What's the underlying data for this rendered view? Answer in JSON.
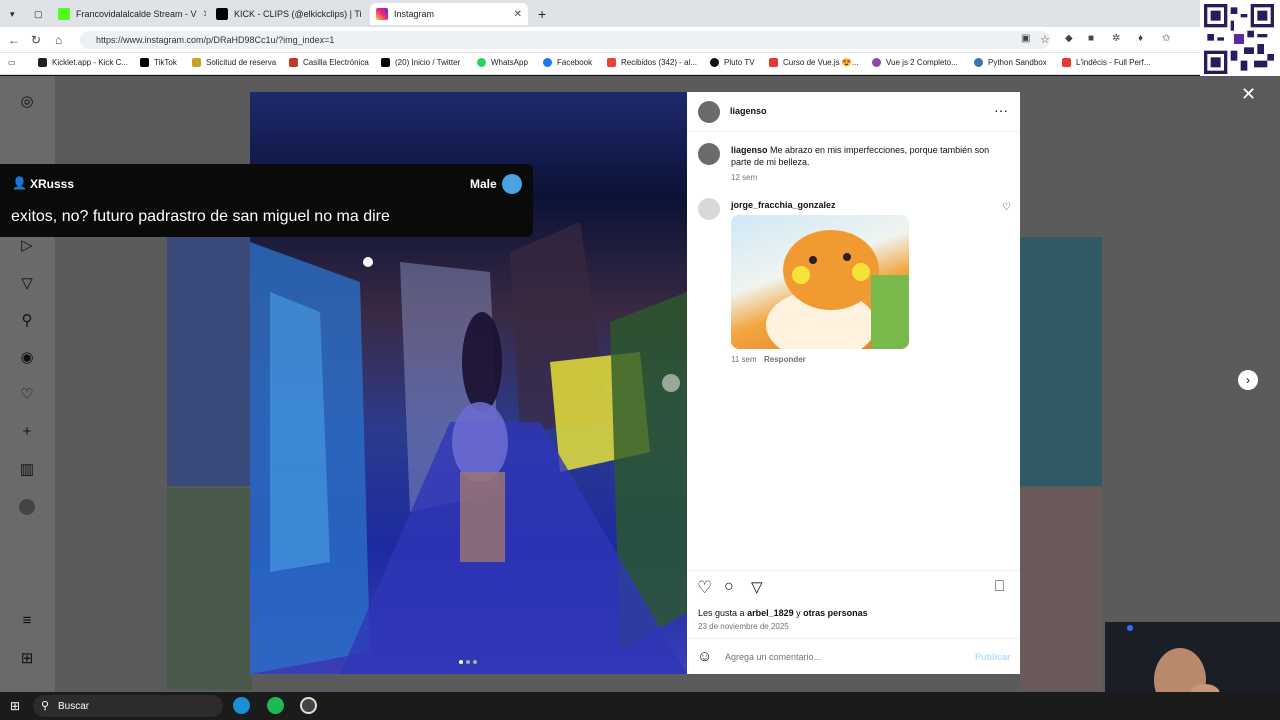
{
  "browser": {
    "tabs": [
      {
        "label": "Francovidalalcalde Stream - V",
        "color": "#53fc18"
      },
      {
        "label": "KICK - CLIPS (@elkickclips) | Ti",
        "color": "#000000"
      },
      {
        "label": "Instagram",
        "color": "#d62976"
      }
    ],
    "url": "https://www.instagram.com/p/DRaHD98Cc1u/?img_index=1",
    "bookmarks": [
      {
        "label": "Kicklet.app - Kick C...",
        "color": "#222"
      },
      {
        "label": "TikTok",
        "color": "#000"
      },
      {
        "label": "Solicitud de reserva",
        "color": "#c9a227"
      },
      {
        "label": "Casilla Electrónica",
        "color": "#c0392b"
      },
      {
        "label": "(20) Inicio / Twitter",
        "color": "#000"
      },
      {
        "label": "WhatsApp",
        "color": "#25d366"
      },
      {
        "label": "Facebook",
        "color": "#1877f2"
      },
      {
        "label": "Recibidos (342) - al...",
        "color": "#ea4335"
      },
      {
        "label": "Pluto TV",
        "color": "#111"
      },
      {
        "label": "Curso de Vue.js 😍...",
        "color": "#e53935"
      },
      {
        "label": "Vue js 2 Completo...",
        "color": "#8e44ad"
      },
      {
        "label": "Python Sandbox",
        "color": "#3776ab"
      },
      {
        "label": "L'indécis - Full Perf...",
        "color": "#e53935"
      }
    ]
  },
  "chat": {
    "username": "XRusss",
    "gender": "Male",
    "message": "exitos, no? futuro padrastro de san miguel no ma dire"
  },
  "post": {
    "author": "liagenso",
    "caption_author": "liagenso",
    "caption": "Me abrazo en mis imperfecciones, porque también son parte de mi belleza.",
    "caption_time": "12 sem",
    "comment": {
      "author": "jorge_fracchia_gonzalez",
      "time": "11 sem",
      "reply": "Responder"
    },
    "likes_prefix": "Les gusta a",
    "likes_user": "arbel_1829",
    "likes_join": "y",
    "likes_others": "otras personas",
    "date": "23 de noviembre de 2025",
    "comment_placeholder": "Agrega un comentario...",
    "publish": "Publicar"
  },
  "taskbar": {
    "search": "Buscar"
  },
  "colors": {
    "accent": "#0095f6",
    "publish_disabled": "#b2dffc"
  }
}
